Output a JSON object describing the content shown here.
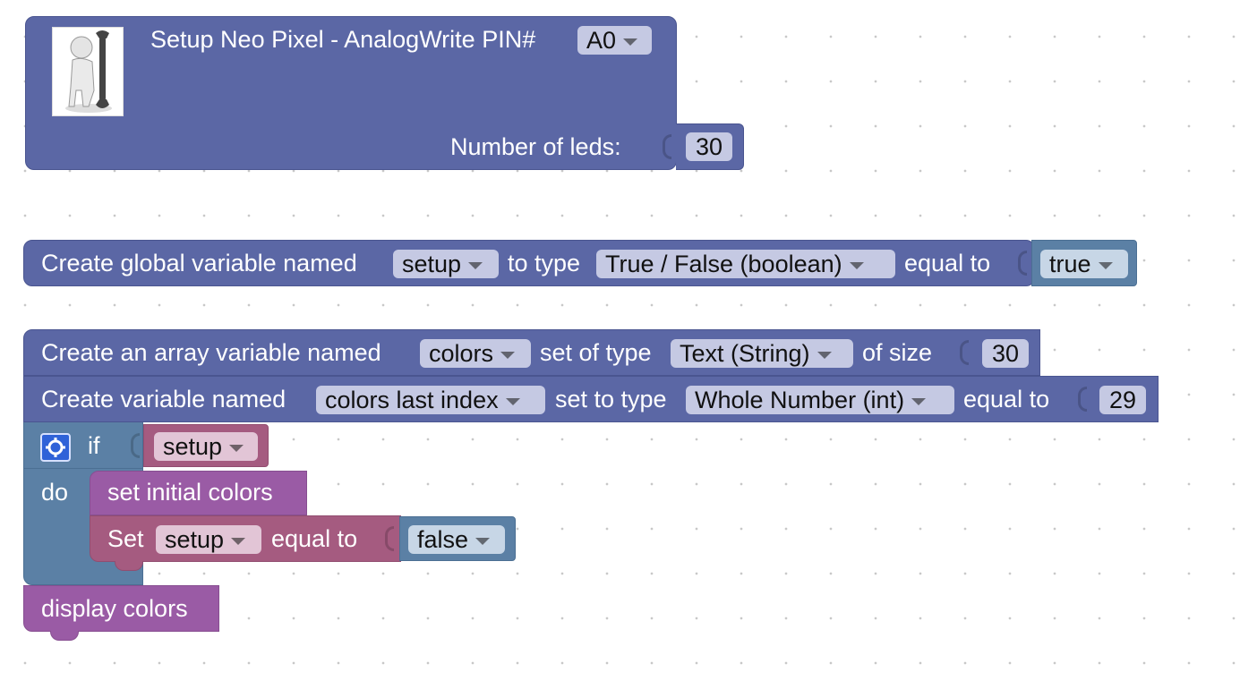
{
  "neo_pixel_block": {
    "title": "Setup Neo Pixel - AnalogWrite PIN#",
    "pin_value": "A0",
    "leds_label": "Number of leds:",
    "leds_value": "30"
  },
  "global_var_block": {
    "label_create": "Create global variable named",
    "var_name": "setup",
    "label_type": "to type",
    "type_value": "True / False (boolean)",
    "label_equal": "equal to",
    "value": "true"
  },
  "array_block": {
    "label_create": "Create an array variable named",
    "var_name": "colors",
    "label_type": "set of type",
    "type_value": "Text (String)",
    "label_size": "of size",
    "size_value": "30"
  },
  "index_var_block": {
    "label_create": "Create variable named",
    "var_name": "colors last index",
    "label_type": "set to type",
    "type_value": "Whole Number (int)",
    "label_equal": "equal to",
    "value": "29"
  },
  "if_block": {
    "label_if": "if",
    "condition": "setup",
    "label_do": "do"
  },
  "proc_initial": {
    "label": "set initial colors"
  },
  "set_block": {
    "label_set": "Set",
    "var_name": "setup",
    "label_equal": "equal to",
    "value": "false"
  },
  "proc_display": {
    "label": "display colors"
  },
  "colors": {
    "setup_block": "#5b67a5",
    "if_block": "#5b80a5",
    "procedure_block": "#9a5ba5",
    "set_block": "#a55b80",
    "gear_icon": "#2f62d8"
  }
}
